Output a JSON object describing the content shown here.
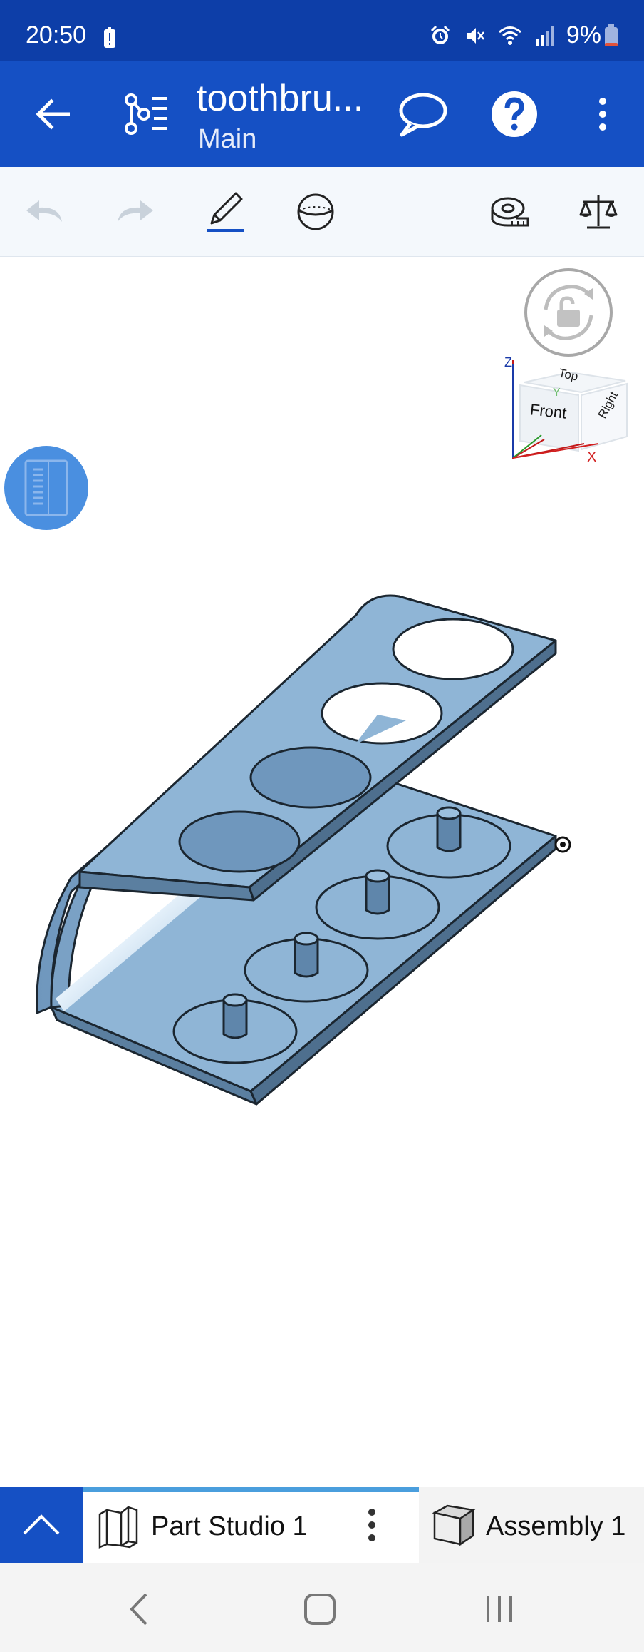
{
  "status_bar": {
    "time": "20:50",
    "battery": "9%"
  },
  "app_bar": {
    "title": "toothbru...",
    "subtitle": "Main"
  },
  "view_cube": {
    "top": "Top",
    "front": "Front",
    "right": "Right",
    "axis_x": "X",
    "axis_y": "Y",
    "axis_z": "Z"
  },
  "tabs": [
    {
      "label": "Part Studio 1",
      "active": true
    },
    {
      "label": "Assembly 1",
      "active": false
    }
  ],
  "colors": {
    "brand": "#1550c4",
    "status": "#0d3ea8",
    "model_fill": "#8fb5d6",
    "model_edge": "#1b2630"
  }
}
